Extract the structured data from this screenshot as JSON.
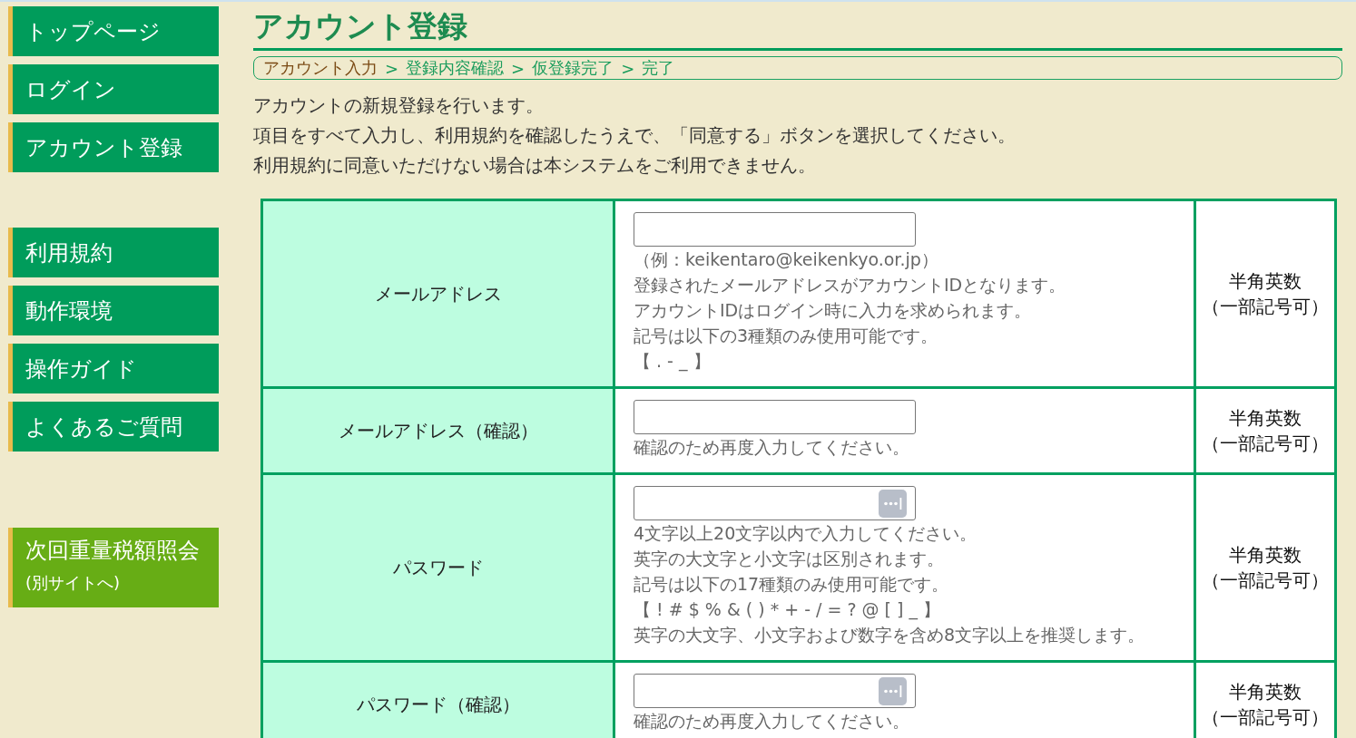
{
  "sidebar": {
    "groups": [
      {
        "items": [
          {
            "kind": "internal",
            "label": "トップページ"
          },
          {
            "kind": "internal",
            "label": "ログイン"
          },
          {
            "kind": "internal",
            "label": "アカウント登録"
          }
        ]
      },
      {
        "items": [
          {
            "kind": "internal",
            "label": "利用規約"
          },
          {
            "kind": "internal",
            "label": "動作環境"
          },
          {
            "kind": "internal",
            "label": "操作ガイド"
          },
          {
            "kind": "internal",
            "label": "よくあるご質問"
          }
        ]
      },
      {
        "items": [
          {
            "kind": "external",
            "label": "次回重量税額照会",
            "sublabel": "(別サイトへ)"
          }
        ]
      }
    ]
  },
  "page": {
    "title": "アカウント登録",
    "breadcrumb": {
      "separator": ">",
      "steps": [
        {
          "label": "アカウント入力",
          "selected": true
        },
        {
          "label": "登録内容確認",
          "selected": false
        },
        {
          "label": "仮登録完了",
          "selected": false
        },
        {
          "label": "完了",
          "selected": false
        }
      ]
    },
    "intro": [
      "アカウントの新規登録を行います。",
      "項目をすべて入力し、利用規約を確認したうえで、「同意する」ボタンを選択してください。",
      "利用規約に同意いただけない場合は本システムをご利用できません。"
    ],
    "form": {
      "rows": [
        {
          "label": "メールアドレス",
          "field": {
            "kind": "text"
          },
          "hints": [
            "（例：keikentaro@keikenkyo.or.jp）",
            "登録されたメールアドレスがアカウントIDとなります。",
            "アカウントIDはログイン時に入力を求められます。",
            "記号は以下の3種類のみ使用可能です。",
            "【 . - _ 】"
          ],
          "note": [
            "半角英数",
            "（一部記号可）"
          ]
        },
        {
          "label": "メールアドレス（確認）",
          "field": {
            "kind": "text"
          },
          "hints": [
            "確認のため再度入力してください。"
          ],
          "note": [
            "半角英数",
            "（一部記号可）"
          ]
        },
        {
          "label": "パスワード",
          "field": {
            "kind": "password"
          },
          "hints": [
            "4文字以上20文字以内で入力してください。",
            "英字の大文字と小文字は区別されます。",
            "記号は以下の17種類のみ使用可能です。",
            "【 ! # $ % & ( ) * + - / = ? @ [ ] _ 】",
            "英字の大文字、小文字および数字を含め8文字以上を推奨します。"
          ],
          "note": [
            "半角英数",
            "（一部記号可）"
          ]
        },
        {
          "label": "パスワード（確認）",
          "field": {
            "kind": "password"
          },
          "hints": [
            "確認のため再度入力してください。"
          ],
          "note": [
            "半角英数",
            "（一部記号可）"
          ]
        }
      ]
    }
  }
}
